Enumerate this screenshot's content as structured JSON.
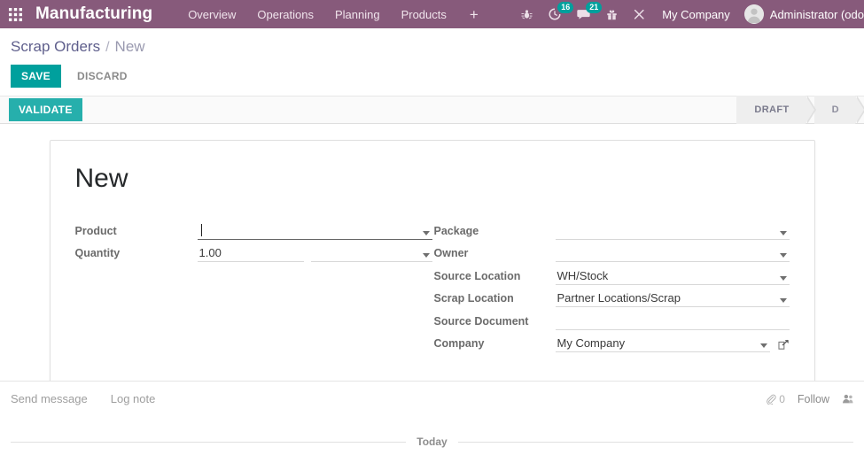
{
  "topbar": {
    "apps_icon": "apps-grid-icon",
    "brand": "Manufacturing",
    "nav": [
      {
        "label": "Overview"
      },
      {
        "label": "Operations"
      },
      {
        "label": "Planning"
      },
      {
        "label": "Products"
      }
    ],
    "add_label": "+",
    "sys_icons": [
      {
        "name": "debug-bug-icon",
        "glyph": "✵",
        "badge": null
      },
      {
        "name": "activity-clock-icon",
        "glyph": "◔",
        "badge": "16"
      },
      {
        "name": "messages-chat-icon",
        "glyph": "●",
        "badge": "21"
      },
      {
        "name": "gift-icon",
        "glyph": "⌂",
        "badge": null
      },
      {
        "name": "tools-wrench-icon",
        "glyph": "✖",
        "badge": null
      }
    ],
    "company": "My Company",
    "user": "Administrator (odo",
    "colors": {
      "header_bg": "#875A7B",
      "badge_bg": "#00A09D"
    }
  },
  "breadcrumb": {
    "parent": "Scrap Orders",
    "separator": "/",
    "current": "New"
  },
  "actions": {
    "save_label": "SAVE",
    "discard_label": "DISCARD",
    "validate_label": "VALIDATE",
    "save_color": "#00A09D",
    "validate_color": "#26AFAC"
  },
  "statusbar": {
    "states": [
      {
        "label": "DRAFT",
        "active": true
      },
      {
        "label": "D",
        "active": false
      }
    ]
  },
  "form": {
    "title": "New",
    "left_fields": [
      {
        "label": "Product",
        "value": "",
        "placeholder": "",
        "has_dropdown": true,
        "focused": true,
        "name": "product"
      },
      {
        "label": "Quantity",
        "value": "1.00",
        "uom_value": "",
        "has_dropdown": true,
        "focused": false,
        "name": "quantity"
      }
    ],
    "right_fields": [
      {
        "label": "Package",
        "value": "",
        "has_dropdown": true,
        "name": "package"
      },
      {
        "label": "Owner",
        "value": "",
        "has_dropdown": true,
        "name": "owner"
      },
      {
        "label": "Source Location",
        "value": "WH/Stock",
        "has_dropdown": true,
        "name": "source-location"
      },
      {
        "label": "Scrap Location",
        "value": "Partner Locations/Scrap",
        "has_dropdown": true,
        "name": "scrap-location"
      },
      {
        "label": "Source Document",
        "value": "",
        "has_dropdown": false,
        "name": "source-document"
      },
      {
        "label": "Company",
        "value": "My Company",
        "has_dropdown": true,
        "has_external_link": true,
        "name": "company"
      }
    ]
  },
  "chatter": {
    "send_message": "Send message",
    "log_note": "Log note",
    "attachment_icon": "paperclip-icon",
    "attachment_count": "0",
    "follow_label": "Follow",
    "followers_icon": "followers-people-icon",
    "today_label": "Today"
  }
}
